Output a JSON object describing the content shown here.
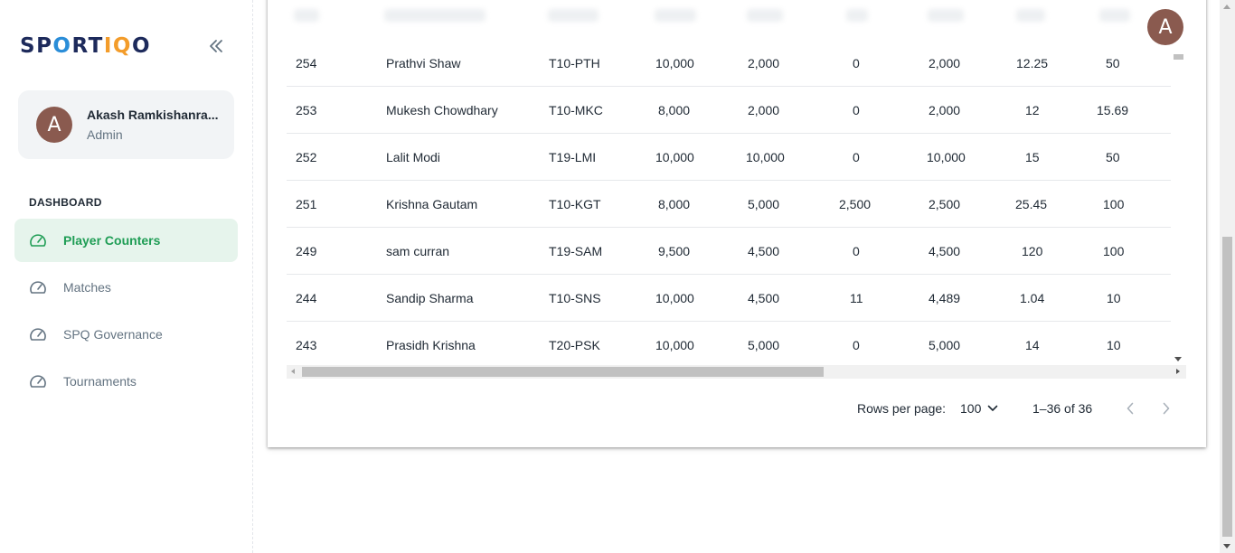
{
  "brand": {
    "logo_text": "SPORTIQO",
    "colors": {
      "navy": "#1d2a5b",
      "blue": "#2a8dd8",
      "orange": "#f39c2a"
    }
  },
  "sidebar": {
    "collapse_icon": "double-chevron-left-icon",
    "account": {
      "avatar_letter": "A",
      "name": "Akash Ramkishanra...",
      "role": "Admin"
    },
    "section_title": "DASHBOARD",
    "items": [
      {
        "label": "Player Counters",
        "icon": "gauge-icon",
        "active": true
      },
      {
        "label": "Matches",
        "icon": "gauge-icon",
        "active": false
      },
      {
        "label": "SPQ Governance",
        "icon": "gauge-icon",
        "active": false
      },
      {
        "label": "Tournaments",
        "icon": "gauge-icon",
        "active": false
      }
    ],
    "active_color": "#1f9d55",
    "active_bg": "#e6f4ec"
  },
  "header": {
    "avatar_letter": "A",
    "avatar_color": "#8a5a4f"
  },
  "table": {
    "rows": [
      {
        "id": "254",
        "name": "Prathvi Shaw",
        "code": "T10-PTH",
        "c1": "10,000",
        "c2": "2,000",
        "c3": "0",
        "c4": "2,000",
        "c5": "12.25",
        "c6": "50"
      },
      {
        "id": "253",
        "name": "Mukesh Chowdhary",
        "code": "T10-MKC",
        "c1": "8,000",
        "c2": "2,000",
        "c3": "0",
        "c4": "2,000",
        "c5": "12",
        "c6": "15.69"
      },
      {
        "id": "252",
        "name": "Lalit Modi",
        "code": "T19-LMI",
        "c1": "10,000",
        "c2": "10,000",
        "c3": "0",
        "c4": "10,000",
        "c5": "15",
        "c6": "50"
      },
      {
        "id": "251",
        "name": "Krishna Gautam",
        "code": "T10-KGT",
        "c1": "8,000",
        "c2": "5,000",
        "c3": "2,500",
        "c4": "2,500",
        "c5": "25.45",
        "c6": "100"
      },
      {
        "id": "249",
        "name": "sam curran",
        "code": "T19-SAM",
        "c1": "9,500",
        "c2": "4,500",
        "c3": "0",
        "c4": "4,500",
        "c5": "120",
        "c6": "100"
      },
      {
        "id": "244",
        "name": "Sandip Sharma",
        "code": "T10-SNS",
        "c1": "10,000",
        "c2": "4,500",
        "c3": "11",
        "c4": "4,489",
        "c5": "1.04",
        "c6": "10"
      },
      {
        "id": "243",
        "name": "Prasidh Krishna",
        "code": "T20-PSK",
        "c1": "10,000",
        "c2": "5,000",
        "c3": "0",
        "c4": "5,000",
        "c5": "14",
        "c6": "10"
      }
    ]
  },
  "pagination": {
    "rows_per_page_label": "Rows per page:",
    "rows_per_page_value": "100",
    "range_text": "1–36 of 36"
  }
}
